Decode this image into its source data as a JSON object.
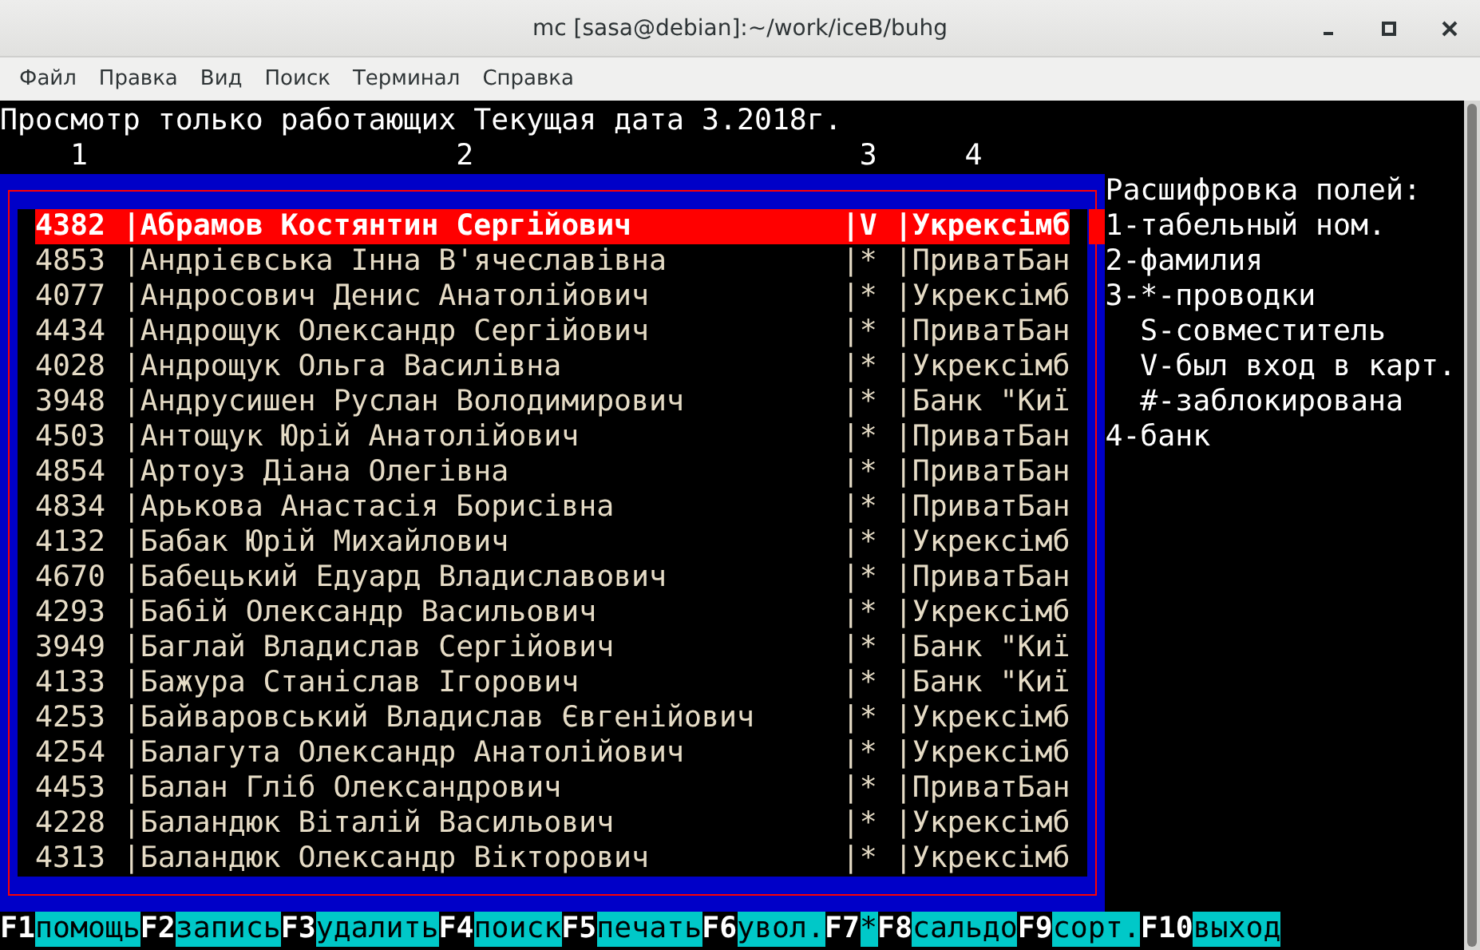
{
  "window": {
    "title": "mc [sasa@debian]:~/work/iceB/buhg"
  },
  "menu": [
    "Файл",
    "Правка",
    "Вид",
    "Поиск",
    "Терминал",
    "Справка"
  ],
  "terminal": {
    "header": "Просмотр только работающих Текущая дата 3.2018г.",
    "column_numbers": [
      "1",
      "2",
      "3",
      "4"
    ],
    "rows": [
      {
        "number": "4382",
        "name": "|Абрамов Костянтин Сергійович",
        "flag": "|V",
        "bank": "|Укрексімб",
        "selected": true
      },
      {
        "number": "4853",
        "name": "|Андрієвська Інна В'ячеславівна",
        "flag": "|*",
        "bank": "|ПриватБан",
        "selected": false
      },
      {
        "number": "4077",
        "name": "|Андросович Денис Анатолійович",
        "flag": "|*",
        "bank": "|Укрексімб",
        "selected": false
      },
      {
        "number": "4434",
        "name": "|Андрощук Олександр Сергійович",
        "flag": "|*",
        "bank": "|ПриватБан",
        "selected": false
      },
      {
        "number": "4028",
        "name": "|Андрощук Ольга Василівна",
        "flag": "|*",
        "bank": "|Укрексімб",
        "selected": false
      },
      {
        "number": "3948",
        "name": "|Андрусишен Руслан Володимирович",
        "flag": "|*",
        "bank": "|Банк \"Киї",
        "selected": false
      },
      {
        "number": "4503",
        "name": "|Антощук Юрій Анатолійович",
        "flag": "|*",
        "bank": "|ПриватБан",
        "selected": false
      },
      {
        "number": "4854",
        "name": "|Артоуз Діана Олегівна",
        "flag": "|*",
        "bank": "|ПриватБан",
        "selected": false
      },
      {
        "number": "4834",
        "name": "|Арькова Анастасія Борисівна",
        "flag": "|*",
        "bank": "|ПриватБан",
        "selected": false
      },
      {
        "number": "4132",
        "name": "|Бабак Юрій Михайлович",
        "flag": "|*",
        "bank": "|Укрексімб",
        "selected": false
      },
      {
        "number": "4670",
        "name": "|Бабецький Едуард Владиславович",
        "flag": "|*",
        "bank": "|ПриватБан",
        "selected": false
      },
      {
        "number": "4293",
        "name": "|Бабій Олександр Васильович",
        "flag": "|*",
        "bank": "|Укрексімб",
        "selected": false
      },
      {
        "number": "3949",
        "name": "|Баглай Владислав Сергійович",
        "flag": "|*",
        "bank": "|Банк \"Киї",
        "selected": false
      },
      {
        "number": "4133",
        "name": "|Бажура Станіслав Ігорович",
        "flag": "|*",
        "bank": "|Банк \"Киї",
        "selected": false
      },
      {
        "number": "4253",
        "name": "|Байваровський Владислав Євгенійович",
        "flag": "|*",
        "bank": "|Укрексімб",
        "selected": false
      },
      {
        "number": "4254",
        "name": "|Балагута Олександр Анатолійович",
        "flag": "|*",
        "bank": "|Укрексімб",
        "selected": false
      },
      {
        "number": "4453",
        "name": "|Балан Гліб Олександрович",
        "flag": "|*",
        "bank": "|ПриватБан",
        "selected": false
      },
      {
        "number": "4228",
        "name": "|Баландюк Віталій Васильович",
        "flag": "|*",
        "bank": "|Укрексімб",
        "selected": false
      },
      {
        "number": "4313",
        "name": "|Баландюк Олександр Вікторович",
        "flag": "|*",
        "bank": "|Укрексімб",
        "selected": false
      }
    ],
    "legend_title": "Расшифровка полей:",
    "legend": [
      {
        "text": "1-табельный ном."
      },
      {
        "text": "2-фамилия"
      },
      {
        "text": "3-*-проводки",
        "children": [
          {
            "text": "S-совместитель"
          },
          {
            "text": "V-был вход в карт."
          },
          {
            "text": "#-заблокирована"
          }
        ]
      },
      {
        "text": "4-банк"
      }
    ],
    "function_keys": [
      {
        "key": "F1",
        "label": "помощь"
      },
      {
        "key": "F2",
        "label": "запись"
      },
      {
        "key": "F3",
        "label": "удалить"
      },
      {
        "key": "F4",
        "label": "поиск"
      },
      {
        "key": "F5",
        "label": "печать"
      },
      {
        "key": "F6",
        "label": "увол."
      },
      {
        "key": "F7",
        "label": "*"
      },
      {
        "key": "F8",
        "label": "сальдо"
      },
      {
        "key": "F9",
        "label": "сорт."
      },
      {
        "key": "F10",
        "label": "выход"
      }
    ]
  }
}
